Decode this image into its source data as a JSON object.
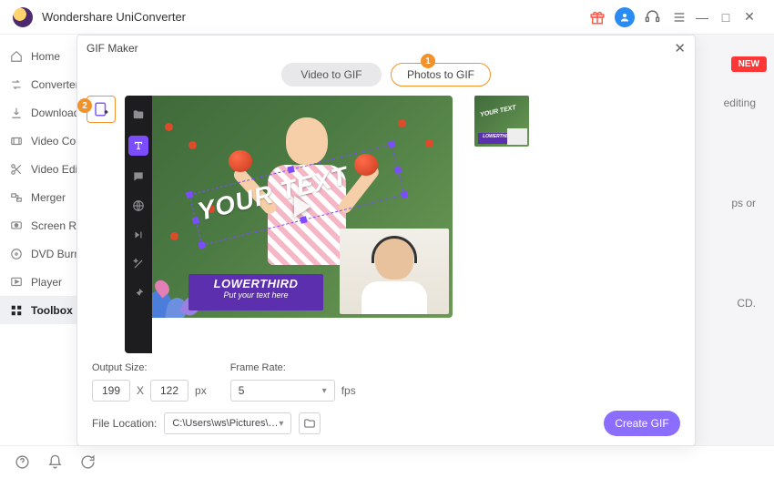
{
  "app": {
    "title": "Wondershare UniConverter"
  },
  "titlebar": {
    "avatar_icon": "user",
    "gift_icon": "gift",
    "support_icon": "headset",
    "menu_icon": "menu",
    "min": "—",
    "max": "□",
    "close": "✕"
  },
  "sidebar": {
    "items": [
      {
        "label": "Home",
        "icon": "home"
      },
      {
        "label": "Converter",
        "icon": "convert"
      },
      {
        "label": "Downloader",
        "icon": "download"
      },
      {
        "label": "Video Compressor",
        "icon": "compress"
      },
      {
        "label": "Video Editor",
        "icon": "scissors"
      },
      {
        "label": "Merger",
        "icon": "merge"
      },
      {
        "label": "Screen Recorder",
        "icon": "record"
      },
      {
        "label": "DVD Burner",
        "icon": "disc"
      },
      {
        "label": "Player",
        "icon": "play"
      },
      {
        "label": "Toolbox",
        "icon": "grid"
      }
    ],
    "active_index": 9
  },
  "background": {
    "new_badge": "NEW",
    "line1": "editing",
    "line2": "ps or",
    "line3": "CD."
  },
  "modal": {
    "title": "GIF Maker",
    "tabs": {
      "video": "Video to GIF",
      "photo": "Photos to GIF",
      "active": "photo"
    },
    "callouts": {
      "c1": "1",
      "c2": "2"
    },
    "toolstrip_icons": [
      "folder",
      "text",
      "chat",
      "globe",
      "skip",
      "wand",
      "pin"
    ],
    "toolstrip_active": 1,
    "preview": {
      "overlay_text": "YOUR TEXT",
      "lowerthird_line1": "LOWERTHIRD",
      "lowerthird_line2": "Put your text here"
    },
    "output": {
      "size_label": "Output Size:",
      "width": "199",
      "x_label": "X",
      "height": "122",
      "px_label": "px",
      "framerate_label": "Frame Rate:",
      "framerate_value": "5",
      "fps_label": "fps"
    },
    "file": {
      "location_label": "File Location:",
      "path": "C:\\Users\\ws\\Pictures\\Wonders"
    },
    "create_label": "Create GIF"
  }
}
